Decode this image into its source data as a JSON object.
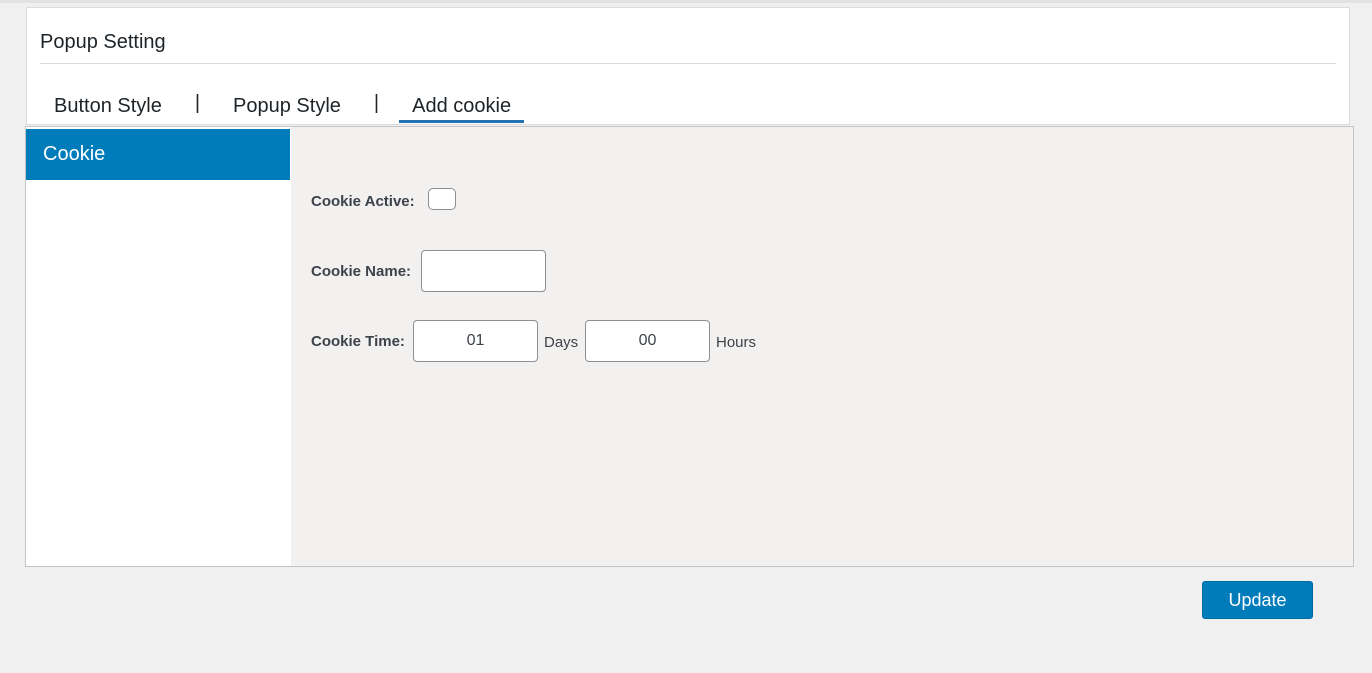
{
  "header": {
    "title": "Popup Setting"
  },
  "tabs": [
    {
      "label": "Button Style",
      "active": false
    },
    {
      "label": "Popup Style",
      "active": false
    },
    {
      "label": "Add cookie",
      "active": true
    }
  ],
  "tab_separator": "|",
  "sidebar": {
    "items": [
      {
        "label": "Cookie",
        "active": true
      }
    ]
  },
  "form": {
    "cookie_active": {
      "label": "Cookie Active:",
      "checked": false
    },
    "cookie_name": {
      "label": "Cookie Name:",
      "value": ""
    },
    "cookie_time": {
      "label": "Cookie Time:",
      "days_value": "01",
      "days_unit": "Days",
      "hours_value": "00",
      "hours_unit": "Hours"
    }
  },
  "actions": {
    "update_label": "Update"
  },
  "colors": {
    "accent": "#007cba",
    "tab_underline": "#2271b1",
    "panel_bg": "#f3f0f0",
    "page_bg": "#f0f0f1"
  }
}
